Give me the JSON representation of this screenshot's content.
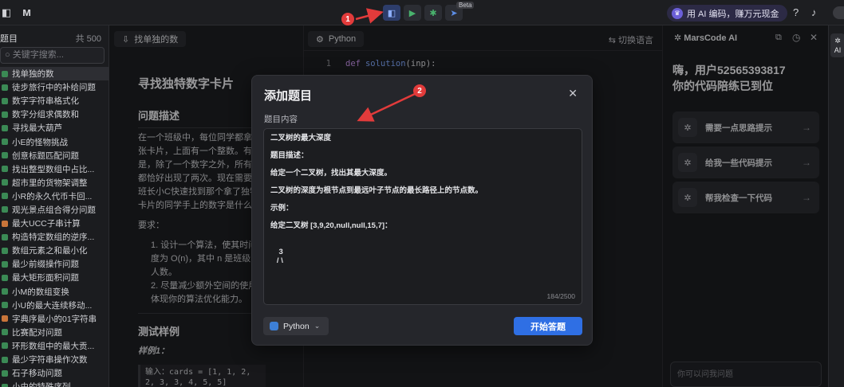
{
  "topbar": {
    "promo_text": "用 AI 编码，赚万元现金",
    "beta_label": "Beta"
  },
  "annotations": {
    "marker1": "1",
    "marker2": "2",
    "color": "#e23b3b"
  },
  "sidebar": {
    "title": "题目",
    "count": "共 500",
    "search_placeholder": "关键字搜索...",
    "items": [
      {
        "label": "找单独的数"
      },
      {
        "label": "徒步旅行中的补给问题"
      },
      {
        "label": "数字字符串格式化"
      },
      {
        "label": "数字分组求偶数和"
      },
      {
        "label": "寻找最大葫芦"
      },
      {
        "label": "小E的怪物挑战"
      },
      {
        "label": "创意标题匹配问题"
      },
      {
        "label": "找出整型数组中占比..."
      },
      {
        "label": "超市里的货物架调整"
      },
      {
        "label": "小R的永久代币卡回..."
      },
      {
        "label": "观光景点组合得分问题"
      },
      {
        "label": "最大UCC子串计算"
      },
      {
        "label": "构造特定数组的逆序..."
      },
      {
        "label": "数组元素之和最小化"
      },
      {
        "label": "最少前缀操作问题"
      },
      {
        "label": "最大矩形面积问题"
      },
      {
        "label": "小M的数组变换"
      },
      {
        "label": "小U的最大连续移动..."
      },
      {
        "label": "字典序最小的01字符串"
      },
      {
        "label": "比赛配对问题"
      },
      {
        "label": "环形数组中的最大贡..."
      },
      {
        "label": "最少字符串操作次数"
      },
      {
        "label": "石子移动问题"
      },
      {
        "label": "小由的特殊序列..."
      }
    ]
  },
  "problem": {
    "tab_label": "找单独的数",
    "title": "寻找独特数字卡片",
    "desc_heading": "问题描述",
    "desc_lines": [
      "在一个班级中，每位同学都拿到",
      "张卡片，上面有一个整数。有趣的",
      "是，除了一个数字之外，所有的数",
      "都恰好出现了两次。现在需要你",
      "班长小C快速找到那个拿了独特数",
      "卡片的同学手上的数字是什么。"
    ],
    "requirements_label": "要求：",
    "req1_lines": [
      "1. 设计一个算法，使其时间复",
      "度为 O(n)，其中 n 是班级的",
      "人数。"
    ],
    "req2_lines": [
      "2. 尽量减少额外空间的使用，",
      "体现你的算法优化能力。"
    ],
    "tests_heading": "测试样例",
    "sample_label": "样例1：",
    "sample_code_line1": "输入：cards = [1, 1, 2,",
    "sample_code_line2": "2, 3, 3, 4, 5, 5]"
  },
  "editor": {
    "language_tab": "Python",
    "switch_language": "切换语言",
    "line_number": "1",
    "code_kw": "def",
    "code_fn": "solution",
    "code_rest": "(inp):"
  },
  "ai_panel": {
    "title": "MarsCode AI",
    "greeting_line1": "嗨，用户52565393817",
    "greeting_line2": "你的代码陪练已到位",
    "actions": [
      {
        "label": "需要一点思路提示"
      },
      {
        "label": "给我一些代码提示"
      },
      {
        "label": "帮我检查一下代码"
      }
    ],
    "input_placeholder": "你可以问我问题",
    "rail_label": "AI"
  },
  "modal": {
    "title": "添加题目",
    "content_label": "题目内容",
    "content_lines": [
      "二叉树的最大深度",
      "",
      "题目描述：",
      "",
      "给定一个二叉树，找出其最大深度。",
      "",
      "二叉树的深度为根节点到最远叶子节点的最长路径上的节点数。",
      "",
      "示例：",
      "",
      "给定二叉树 [3,9,20,null,null,15,7]：",
      "",
      "",
      "    3",
      "   / \\"
    ],
    "char_count": "184/2500",
    "language": "Python",
    "start_button": "开始答题"
  }
}
